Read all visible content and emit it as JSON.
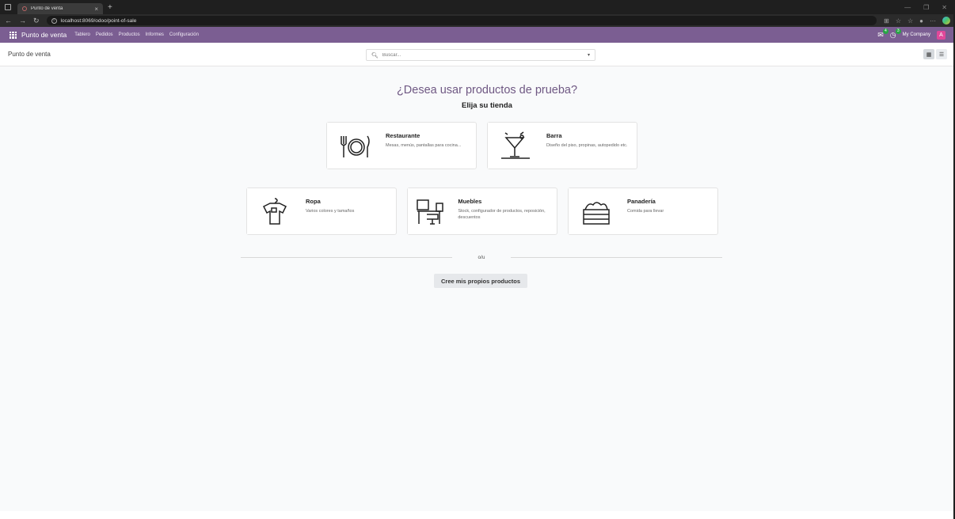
{
  "browser": {
    "tab_title": "Punto de venta",
    "url": "localhost:8069/odoo/point-of-sale"
  },
  "navbar": {
    "brand": "Punto de venta",
    "menu": [
      "Tablero",
      "Pedidos",
      "Productos",
      "Informes",
      "Configuración"
    ],
    "chat_badge": "4",
    "activity_badge": "3",
    "company": "My Company",
    "avatar_letter": "A",
    "accent_color": "#7b5e92"
  },
  "control_panel": {
    "breadcrumb": "Punto de venta",
    "search_placeholder": "Buscar..."
  },
  "main": {
    "headline": "¿Desea usar productos de prueba?",
    "subhead": "Elija su tienda",
    "cards": [
      {
        "title": "Restaurante",
        "desc": "Mesas, menús, pantallas para cocina..."
      },
      {
        "title": "Barra",
        "desc": "Diseño del piso, propinas, autopedido etc."
      },
      {
        "title": "Ropa",
        "desc": "Varios colores y tamaños"
      },
      {
        "title": "Muebles",
        "desc": "Stock, configurador de productos, reposición, descuentos"
      },
      {
        "title": "Panadería",
        "desc": "Comida para llevar"
      }
    ],
    "or_text": "o/u",
    "create_button": "Cree mis propios productos"
  }
}
